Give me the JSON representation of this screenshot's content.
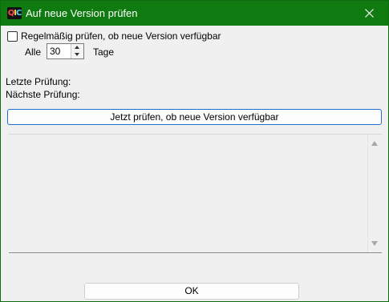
{
  "window": {
    "title": "Auf neue Version prüfen",
    "icon": "qic-app-icon",
    "icon_letters": {
      "q": "Q",
      "i": "I",
      "c": "C"
    },
    "accent_color": "#0f7a0f"
  },
  "settings": {
    "auto_check_label": "Regelmäßig prüfen, ob neue Version verfügbar",
    "auto_check_checked": false,
    "interval_prefix": "Alle",
    "interval_value": "30",
    "interval_suffix": "Tage"
  },
  "status": {
    "last_check_label": "Letzte Prüfung:",
    "next_check_label": "Nächste Prüfung:"
  },
  "actions": {
    "check_now_label": "Jetzt prüfen, ob neue Version verfügbar",
    "ok_label": "OK"
  }
}
